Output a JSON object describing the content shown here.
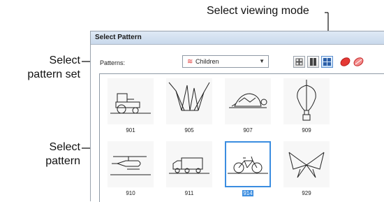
{
  "callouts": {
    "viewing_mode": "Select viewing mode",
    "pattern_set_line1": "Select",
    "pattern_set_line2": "pattern set",
    "pattern_line1": "Select",
    "pattern_line2": "pattern"
  },
  "dialog": {
    "title": "Select Pattern",
    "patterns_label": "Patterns:",
    "pattern_set": {
      "selected": "Children",
      "icon": "pattern-set-icon"
    },
    "view_modes": [
      {
        "name": "small-grid-icon",
        "selected": false
      },
      {
        "name": "large-tiles-icon",
        "selected": false
      },
      {
        "name": "grid-list-icon",
        "selected": true
      }
    ],
    "color_modes": [
      {
        "name": "color-pattern-icon"
      },
      {
        "name": "outline-pattern-icon"
      }
    ],
    "patterns": [
      {
        "label": "901",
        "icon": "tractor-icon",
        "selected": false
      },
      {
        "label": "905",
        "icon": "fan-lines-icon",
        "selected": false
      },
      {
        "label": "907",
        "icon": "turtle-icon",
        "selected": false
      },
      {
        "label": "909",
        "icon": "hot-air-balloon-icon",
        "selected": false
      },
      {
        "label": "910",
        "icon": "helicopter-icon",
        "selected": false
      },
      {
        "label": "911",
        "icon": "truck-icon",
        "selected": false
      },
      {
        "label": "914",
        "icon": "bicycle-icon",
        "selected": true
      },
      {
        "label": "929",
        "icon": "bow-icon",
        "selected": false
      }
    ],
    "accent_color": "#3b8de0"
  }
}
